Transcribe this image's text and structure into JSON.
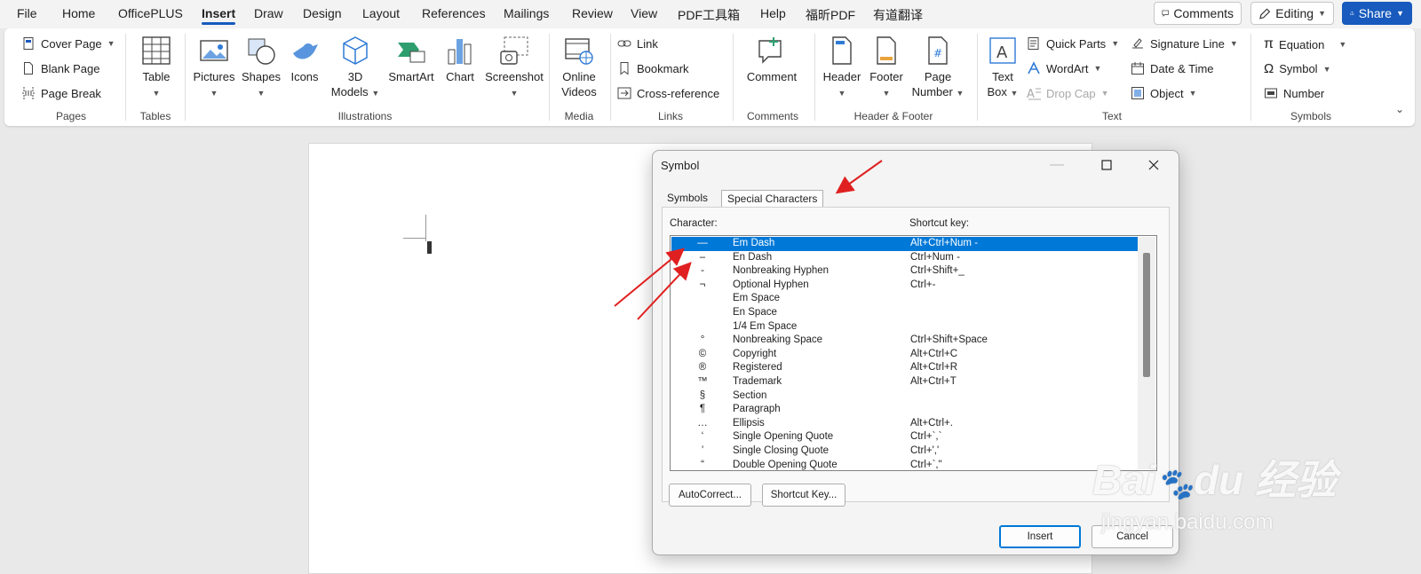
{
  "menubar": {
    "items": [
      "File",
      "Home",
      "OfficePLUS",
      "Insert",
      "Draw",
      "Design",
      "Layout",
      "References",
      "Mailings",
      "Review",
      "View",
      "PDF工具箱",
      "Help",
      "福昕PDF",
      "有道翻译"
    ],
    "active": "Insert",
    "comments_label": "Comments",
    "editing_label": "Editing",
    "share_label": "Share"
  },
  "ribbon": {
    "pages": {
      "cover": "Cover Page",
      "blank": "Blank Page",
      "break": "Page Break",
      "label": "Pages"
    },
    "tables": {
      "table": "Table",
      "label": "Tables"
    },
    "illustrations": {
      "pictures": "Pictures",
      "shapes": "Shapes",
      "icons": "Icons",
      "models_1": "3D",
      "models_2": "Models",
      "smartart": "SmartArt",
      "chart": "Chart",
      "screenshot": "Screenshot",
      "label": "Illustrations"
    },
    "media": {
      "online_1": "Online",
      "online_2": "Videos",
      "label": "Media"
    },
    "links": {
      "link": "Link",
      "bookmark": "Bookmark",
      "crossref": "Cross-reference",
      "label": "Links"
    },
    "comments": {
      "comment": "Comment",
      "label": "Comments"
    },
    "header_footer": {
      "header": "Header",
      "footer": "Footer",
      "page_1": "Page",
      "page_2": "Number",
      "label": "Header & Footer"
    },
    "text": {
      "textbox_1": "Text",
      "textbox_2": "Box",
      "quickparts": "Quick Parts",
      "wordart": "WordArt",
      "dropcap": "Drop Cap",
      "sigline": "Signature Line",
      "datetime": "Date & Time",
      "object": "Object",
      "label": "Text"
    },
    "symbols": {
      "equation": "Equation",
      "symbol": "Symbol",
      "number": "Number",
      "label": "Symbols"
    }
  },
  "dialog": {
    "title": "Symbol",
    "tabs": [
      "Symbols",
      "Special Characters"
    ],
    "selected_tab": "Special Characters",
    "col_character": "Character:",
    "col_shortcut": "Shortcut key:",
    "rows": [
      {
        "char": "—",
        "name": "Em Dash",
        "key": "Alt+Ctrl+Num -"
      },
      {
        "char": "–",
        "name": "En Dash",
        "key": "Ctrl+Num -"
      },
      {
        "char": "‑",
        "name": "Nonbreaking Hyphen",
        "key": "Ctrl+Shift+_"
      },
      {
        "char": "¬",
        "name": "Optional Hyphen",
        "key": "Ctrl+-"
      },
      {
        "char": "",
        "name": "Em Space",
        "key": ""
      },
      {
        "char": "",
        "name": "En Space",
        "key": ""
      },
      {
        "char": "",
        "name": "1/4 Em Space",
        "key": ""
      },
      {
        "char": "°",
        "name": "Nonbreaking Space",
        "key": "Ctrl+Shift+Space"
      },
      {
        "char": "©",
        "name": "Copyright",
        "key": "Alt+Ctrl+C"
      },
      {
        "char": "®",
        "name": "Registered",
        "key": "Alt+Ctrl+R"
      },
      {
        "char": "™",
        "name": "Trademark",
        "key": "Alt+Ctrl+T"
      },
      {
        "char": "§",
        "name": "Section",
        "key": ""
      },
      {
        "char": "¶",
        "name": "Paragraph",
        "key": ""
      },
      {
        "char": "…",
        "name": "Ellipsis",
        "key": "Alt+Ctrl+."
      },
      {
        "char": "‘",
        "name": "Single Opening Quote",
        "key": "Ctrl+`,`"
      },
      {
        "char": "’",
        "name": "Single Closing Quote",
        "key": "Ctrl+','"
      },
      {
        "char": "“",
        "name": "Double Opening Quote",
        "key": "Ctrl+`,\""
      }
    ],
    "selected_row": 0,
    "autocorrect_label": "AutoCorrect...",
    "shortcut_label": "Shortcut Key...",
    "insert_label": "Insert",
    "cancel_label": "Cancel"
  },
  "watermark": {
    "brand": "Bai",
    "brand2": "du",
    "cn": "经验",
    "url": "jingyan.baidu.com"
  },
  "colors": {
    "accent": "#185abd",
    "selection": "#0078d7",
    "annotation": "#e02020"
  }
}
